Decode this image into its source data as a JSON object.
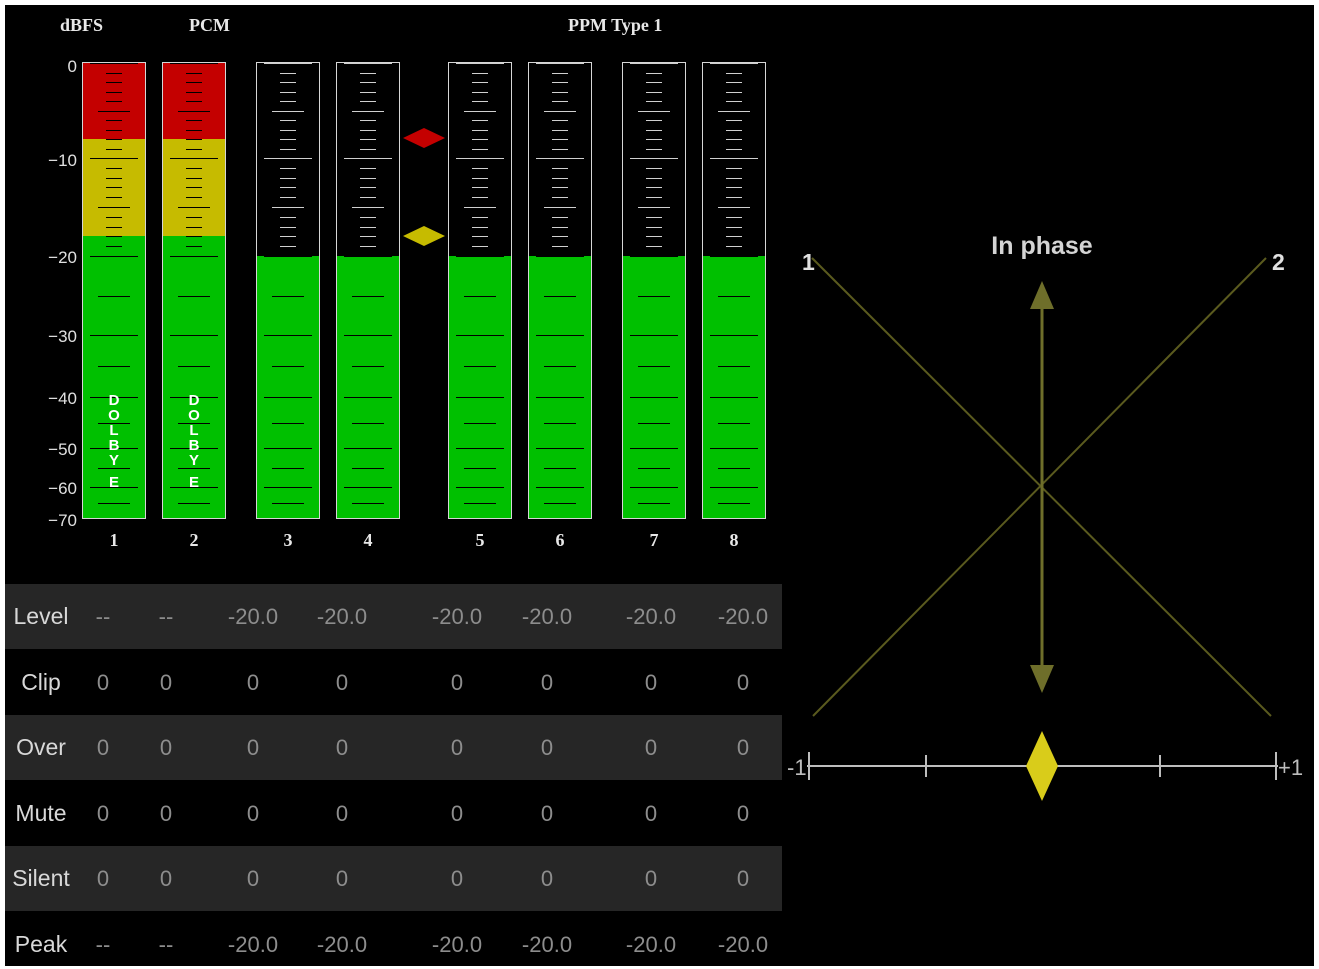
{
  "meter": {
    "scale_title": "dBFS",
    "mode": "PCM",
    "ballistics": "PPM Type 1",
    "scale_labels": [
      "0",
      "−10",
      "−20",
      "−30",
      "−40",
      "−50",
      "−60",
      "−70"
    ],
    "scale_db": [
      0,
      -10,
      -20,
      -30,
      -40,
      -50,
      -60,
      -70
    ],
    "peak_marker_db": -8,
    "test_marker_db": -18,
    "channels": [
      {
        "number": "1",
        "level_db": 0,
        "dolby_letters": [
          "D",
          "O",
          "L",
          "B",
          "Y",
          "E"
        ]
      },
      {
        "number": "2",
        "level_db": 0,
        "dolby_letters": [
          "D",
          "O",
          "L",
          "B",
          "Y",
          "E"
        ]
      },
      {
        "number": "3",
        "level_db": -20.0
      },
      {
        "number": "4",
        "level_db": -20.0
      },
      {
        "number": "5",
        "level_db": -20.0
      },
      {
        "number": "6",
        "level_db": -20.0
      },
      {
        "number": "7",
        "level_db": -20.0
      },
      {
        "number": "8",
        "level_db": -20.0
      }
    ]
  },
  "stats": {
    "rows": [
      {
        "label": "Level",
        "values": [
          "--",
          "--",
          "-20.0",
          "-20.0",
          "-20.0",
          "-20.0",
          "-20.0",
          "-20.0"
        ]
      },
      {
        "label": "Clip",
        "values": [
          "0",
          "0",
          "0",
          "0",
          "0",
          "0",
          "0",
          "0"
        ]
      },
      {
        "label": "Over",
        "values": [
          "0",
          "0",
          "0",
          "0",
          "0",
          "0",
          "0",
          "0"
        ]
      },
      {
        "label": "Mute",
        "values": [
          "0",
          "0",
          "0",
          "0",
          "0",
          "0",
          "0",
          "0"
        ]
      },
      {
        "label": "Silent",
        "values": [
          "0",
          "0",
          "0",
          "0",
          "0",
          "0",
          "0",
          "0"
        ]
      },
      {
        "label": "Peak",
        "values": [
          "--",
          "--",
          "-20.0",
          "-20.0",
          "-20.0",
          "-20.0",
          "-20.0",
          "-20.0"
        ]
      }
    ]
  },
  "phase": {
    "title": "In phase",
    "left_channel": "1",
    "right_channel": "2",
    "scale_min_label": "-1",
    "scale_max_label": "+1",
    "correlation": 0.0
  },
  "colors": {
    "background": "#000000",
    "red_zone": "#c40000",
    "yellow_zone": "#c6bb00",
    "green_zone": "#00c000",
    "phase_lines": "#5a5a1e",
    "phase_arrow": "#6e6e2a",
    "indicator": "#d9cc1a",
    "row_shade": "#262626"
  }
}
